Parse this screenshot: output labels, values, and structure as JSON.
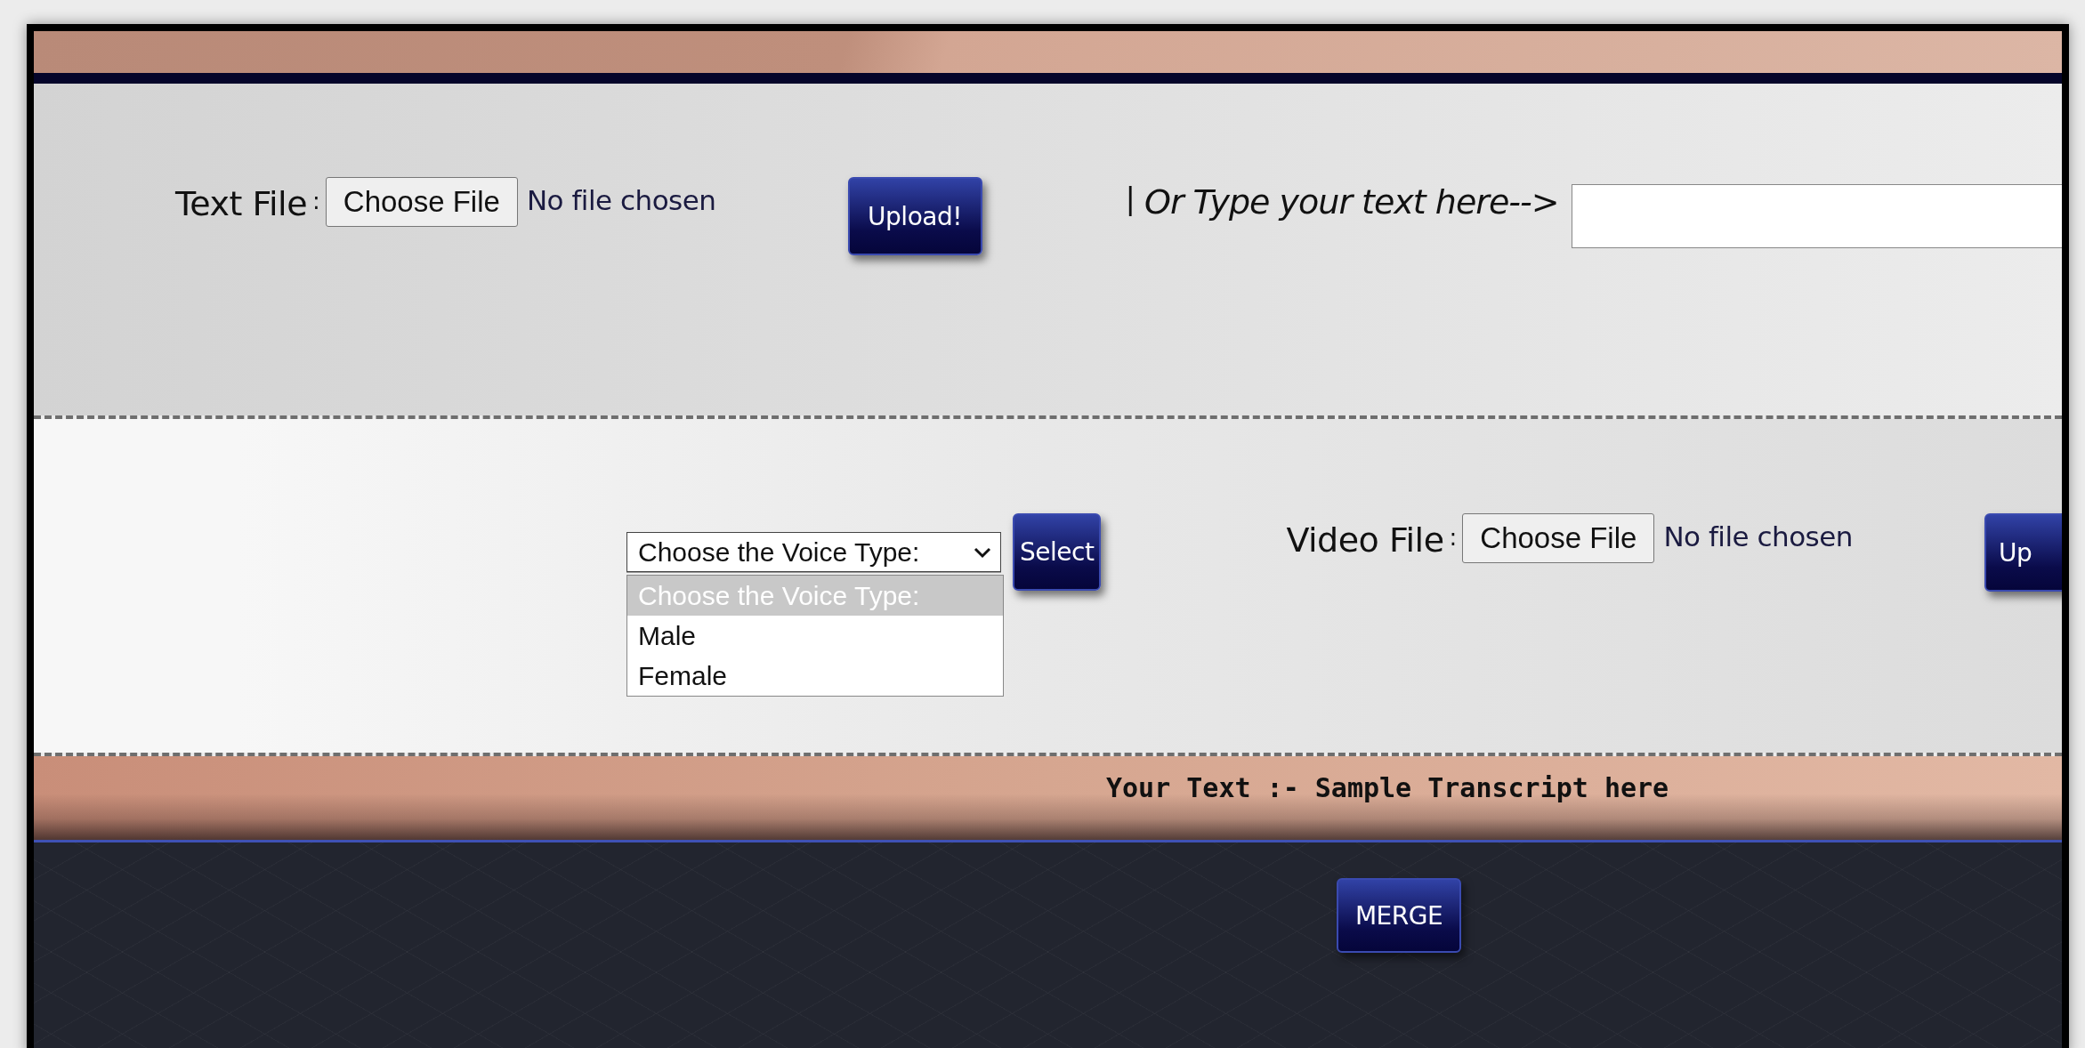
{
  "text_file": {
    "label": "Text File",
    "colon": ":",
    "button": "Choose File",
    "status": "No file chosen"
  },
  "upload_button": "Upload!",
  "type_prompt": {
    "bar": "|",
    "text": "Or Type your text here-->"
  },
  "voice_select": {
    "value": "Choose the Voice Type:",
    "expanded": true,
    "options": [
      {
        "label": "Choose the Voice Type:",
        "selected": true
      },
      {
        "label": "Male",
        "selected": false
      },
      {
        "label": "Female",
        "selected": false
      }
    ]
  },
  "select_button": "Select",
  "video_file": {
    "label": "Video File",
    "colon": ":",
    "button": "Choose File",
    "status": "No file chosen"
  },
  "video_upload_button": "Up",
  "transcript": "Your Text :- Sample Transcript here",
  "merge_button": "MERGE"
}
